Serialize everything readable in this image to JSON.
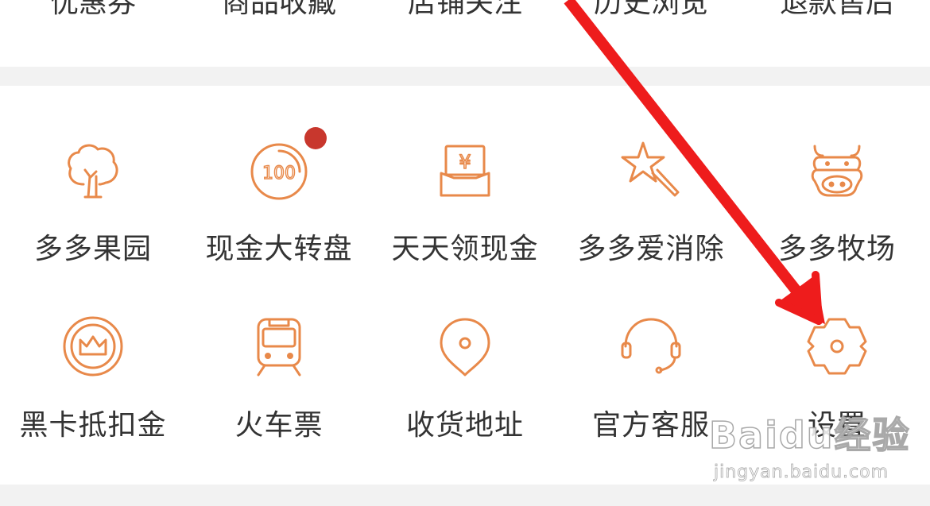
{
  "top_row": {
    "items": [
      {
        "label": "优惠券"
      },
      {
        "label": "商品收藏"
      },
      {
        "label": "店铺关注"
      },
      {
        "label": "历史浏览"
      },
      {
        "label": "退款售后"
      }
    ]
  },
  "services": {
    "row1": [
      {
        "label": "多多果园",
        "icon": "tree-icon"
      },
      {
        "label": "现金大转盘",
        "icon": "cash-wheel-icon",
        "badge": true
      },
      {
        "label": "天天领现金",
        "icon": "cash-envelope-icon"
      },
      {
        "label": "多多爱消除",
        "icon": "magic-wand-star-icon"
      },
      {
        "label": "多多牧场",
        "icon": "cow-icon"
      }
    ],
    "row2": [
      {
        "label": "黑卡抵扣金",
        "icon": "crown-coin-icon"
      },
      {
        "label": "火车票",
        "icon": "train-icon"
      },
      {
        "label": "收货地址",
        "icon": "location-pin-icon"
      },
      {
        "label": "官方客服",
        "icon": "headset-icon"
      },
      {
        "label": "设置",
        "icon": "gear-icon"
      }
    ]
  },
  "icon_text": {
    "wheel_number": "100",
    "yen": "¥"
  },
  "watermark": {
    "logo": "Baidu经验",
    "url": "jingyan.baidu.com"
  },
  "colors": {
    "icon_orange": "#e8894a",
    "badge_red": "#c8372d",
    "arrow_red": "#ee1c1c",
    "text": "#333333",
    "divider": "#f2f2f2"
  }
}
